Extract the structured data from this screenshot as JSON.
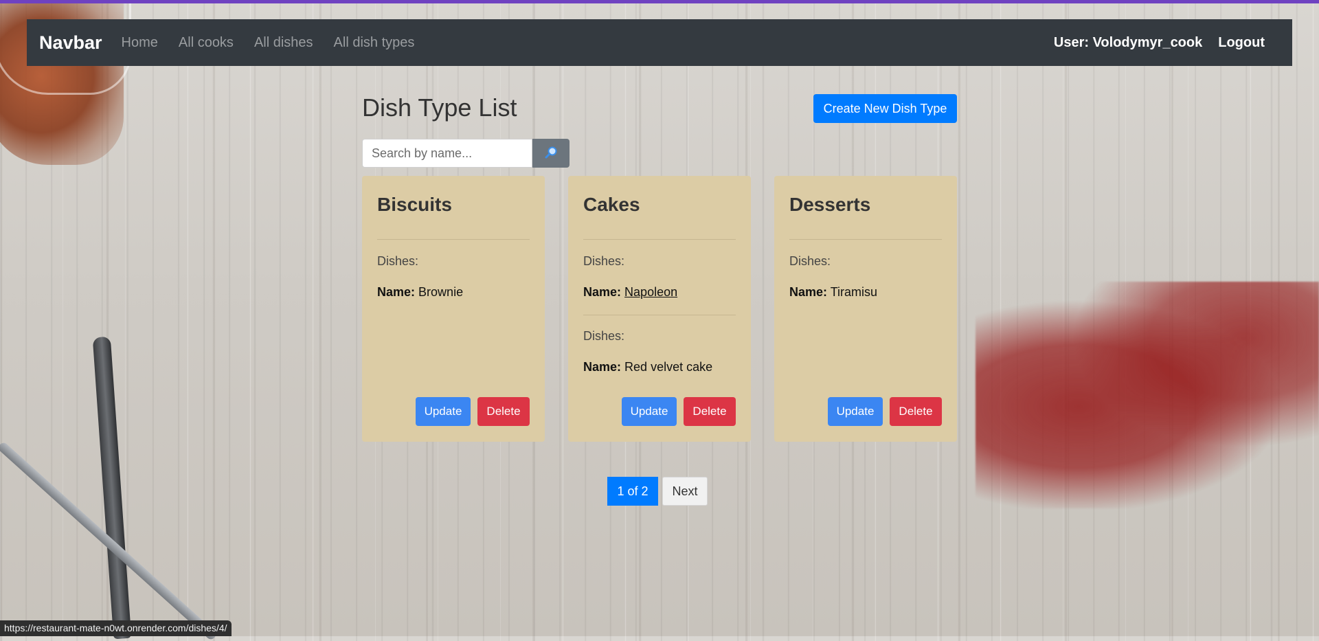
{
  "navbar": {
    "brand": "Navbar",
    "links": [
      "Home",
      "All cooks",
      "All dishes",
      "All dish types"
    ],
    "user": "User: Volodymyr_cook",
    "logout": "Logout"
  },
  "page": {
    "title": "Dish Type List",
    "create_button": "Create New Dish Type"
  },
  "search": {
    "placeholder": "Search by name...",
    "button_icon": "magnifier-icon"
  },
  "cards": [
    {
      "title": "Biscuits",
      "dishes": [
        {
          "label": "Dishes:",
          "name_label": "Name:",
          "name": "Brownie"
        }
      ],
      "update": "Update",
      "delete": "Delete"
    },
    {
      "title": "Cakes",
      "dishes": [
        {
          "label": "Dishes:",
          "name_label": "Name:",
          "name": "Napoleon"
        },
        {
          "label": "Dishes:",
          "name_label": "Name:",
          "name": "Red velvet cake"
        }
      ],
      "update": "Update",
      "delete": "Delete"
    },
    {
      "title": "Desserts",
      "dishes": [
        {
          "label": "Dishes:",
          "name_label": "Name:",
          "name": "Tiramisu"
        }
      ],
      "update": "Update",
      "delete": "Delete"
    }
  ],
  "pagination": {
    "current": "1 of 2",
    "next": "Next"
  },
  "status_bar": {
    "url": "https://restaurant-mate-n0wt.onrender.com/dishes/4/"
  },
  "colors": {
    "navbar_bg": "#343a40",
    "primary": "#007bff",
    "card_bg": "#dccca5",
    "danger": "#dc3545",
    "secondary": "#6c757d"
  }
}
